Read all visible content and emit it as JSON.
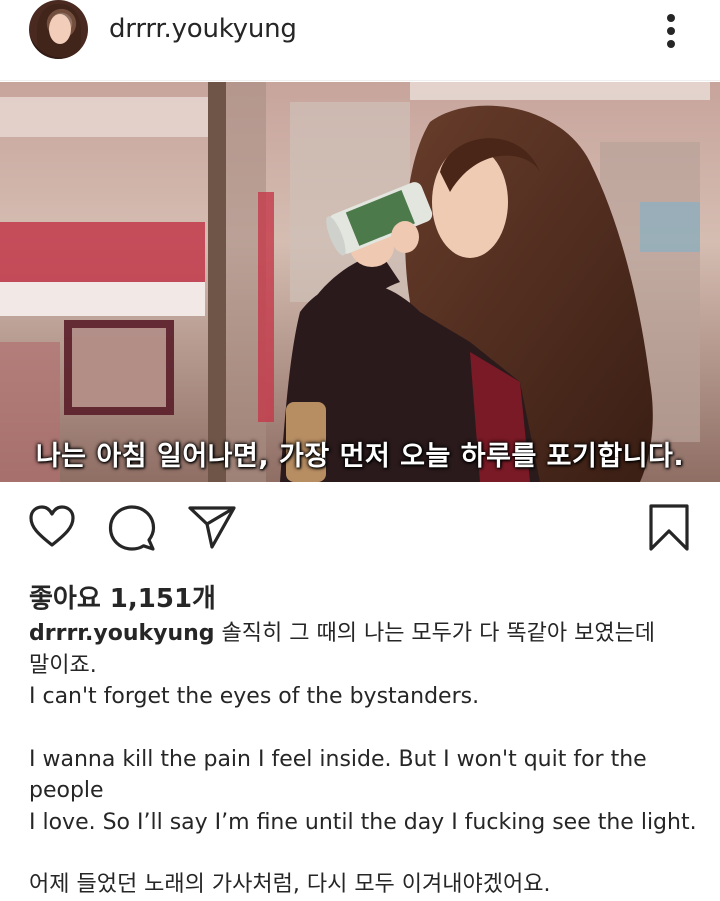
{
  "header": {
    "username": "drrrr.youkyung",
    "avatar_icon": "profile-photo",
    "more_icon": "more-vertical-icon"
  },
  "photo": {
    "subtitle": "나는 아침 일어나면, 가장 먼저 오늘 하루를 포기합니다."
  },
  "actions": {
    "like_icon": "heart-icon",
    "comment_icon": "comment-icon",
    "share_icon": "send-icon",
    "save_icon": "bookmark-icon"
  },
  "likes": {
    "text": "좋아요 1,151개"
  },
  "caption": {
    "username": "drrrr.youkyung",
    "line1": "솔직히 그 때의 나는 모두가 다 똑같아 보였는데",
    "line2": "말이죠.",
    "line3": "I can't forget the eyes of the bystanders.",
    "line4": "I wanna kill the pain I feel inside. But I won't quit for the people",
    "line5": "I love. So I’ll say I’m fine until the day I fucking see the light.",
    "line6": "어제 들었던 노래의 가사처럼, 다시 모두 이겨내야겠어요."
  }
}
